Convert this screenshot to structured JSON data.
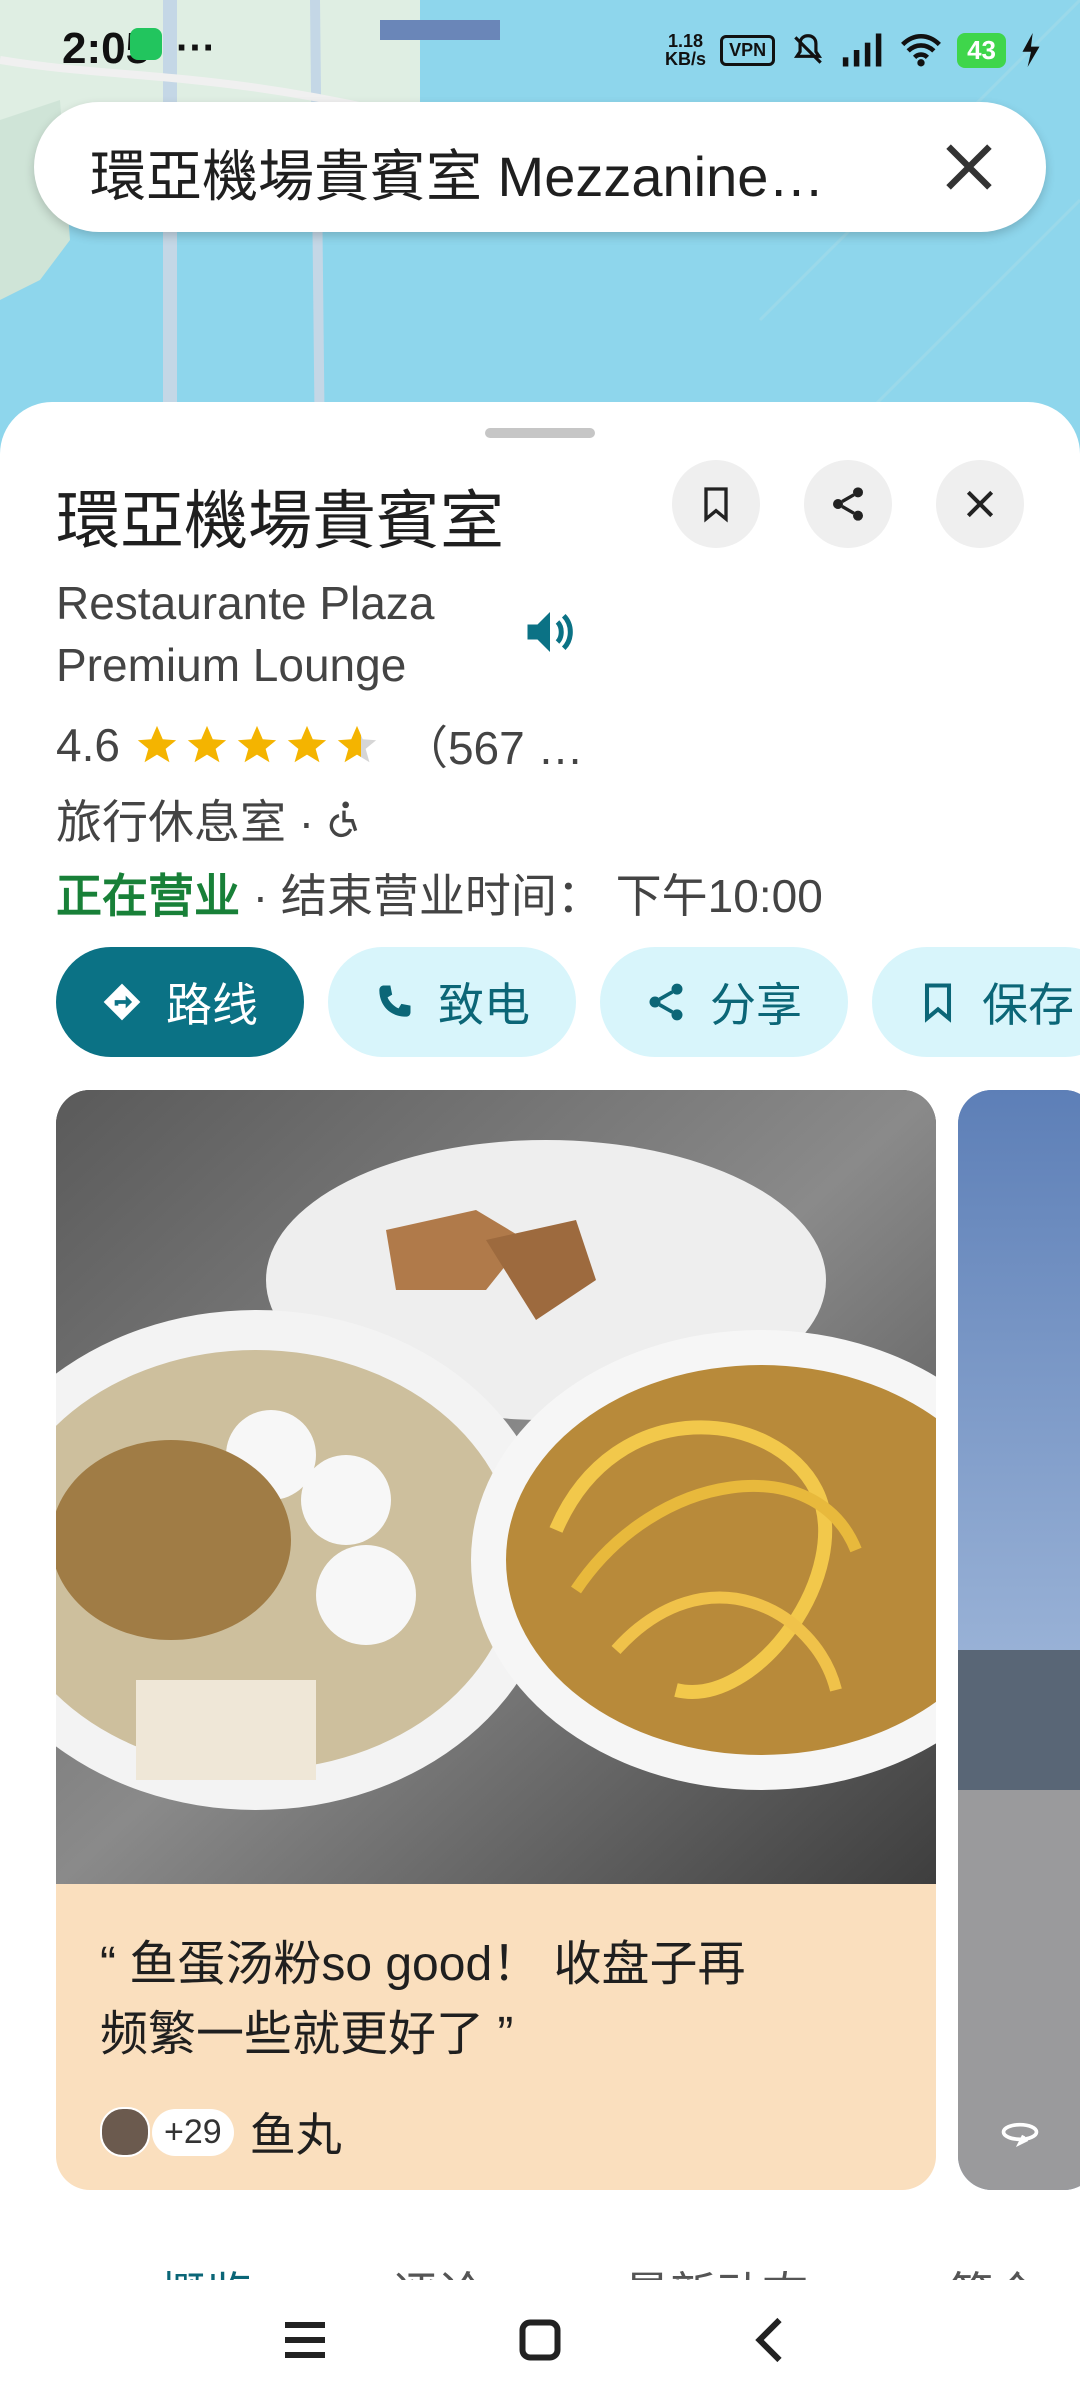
{
  "status_bar": {
    "time": "2:05",
    "extra": "···",
    "net_speed_value": "1.18",
    "net_speed_unit": "KB/s",
    "vpn": "VPN",
    "battery": "43"
  },
  "search": {
    "query": "環亞機場貴賓室 Mezzanine…"
  },
  "place": {
    "title": "環亞機場貴賓室",
    "subtitle_line1": "Restaurante Plaza",
    "subtitle_line2": "Premium Lounge",
    "rating": "4.6",
    "stars": 4.6,
    "review_count": "（567 …",
    "category": "旅行休息室 ·",
    "open_status": "正在营业",
    "closing_text": " · 结束营业时间： 下午10:00"
  },
  "actions": [
    {
      "label": "路线",
      "icon": "directions-icon"
    },
    {
      "label": "致电",
      "icon": "phone-icon"
    },
    {
      "label": "分享",
      "icon": "share-icon"
    },
    {
      "label": "保存",
      "icon": "bookmark-icon"
    }
  ],
  "review_card": {
    "quote_line1": "“ 鱼蛋汤粉so good！ 收盘子再",
    "quote_line2": "频繁一些就更好了 ”",
    "plus_count": "+29",
    "tag": "鱼丸"
  },
  "tabs": [
    "概览",
    "评论",
    "最新动态",
    "简介"
  ],
  "colors": {
    "primary": "#0b7285",
    "chip_bg": "#d8f5fb",
    "open": "#188038",
    "review_bg": "#fadfbe",
    "star": "#f4b400"
  }
}
